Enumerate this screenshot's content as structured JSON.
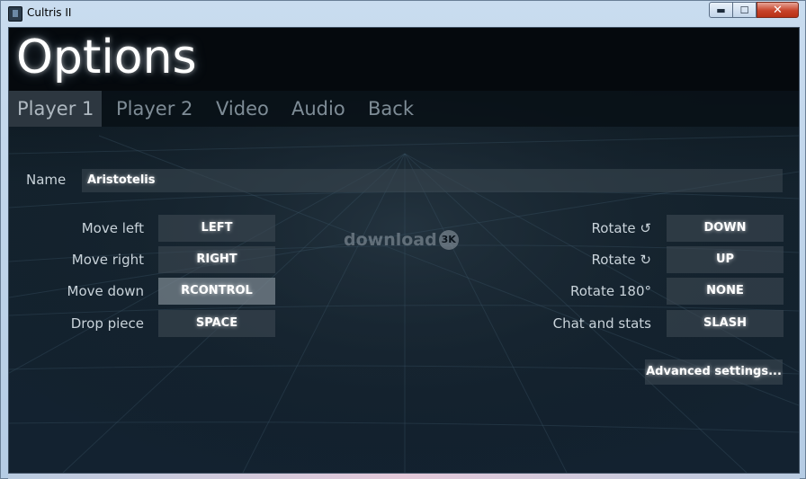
{
  "window": {
    "title": "Cultris II",
    "minimize_glyph": "▬",
    "maximize_glyph": "☐",
    "close_glyph": "✕"
  },
  "page": {
    "title": "Options"
  },
  "tabs": [
    {
      "label": "Player 1",
      "active": true
    },
    {
      "label": "Player 2",
      "active": false
    },
    {
      "label": "Video",
      "active": false
    },
    {
      "label": "Audio",
      "active": false
    },
    {
      "label": "Back",
      "active": false
    }
  ],
  "name": {
    "label": "Name",
    "value": "Aristotelis"
  },
  "controls_left": [
    {
      "label": "Move left",
      "key": "LEFT"
    },
    {
      "label": "Move right",
      "key": "RIGHT"
    },
    {
      "label": "Move down",
      "key": "RCONTROL"
    },
    {
      "label": "Drop piece",
      "key": "SPACE"
    }
  ],
  "controls_right": [
    {
      "label": "Rotate ↺",
      "key": "DOWN"
    },
    {
      "label": "Rotate ↻",
      "key": "UP"
    },
    {
      "label": "Rotate 180°",
      "key": "NONE"
    },
    {
      "label": "Chat and stats",
      "key": "SLASH"
    }
  ],
  "advanced_button": "Advanced settings...",
  "watermark": {
    "text": "download",
    "badge": "3K"
  },
  "colors": {
    "background": "#0b141c",
    "text": "#c9d3da",
    "active_tab": "#2d3740",
    "button": "#3e4a54"
  }
}
